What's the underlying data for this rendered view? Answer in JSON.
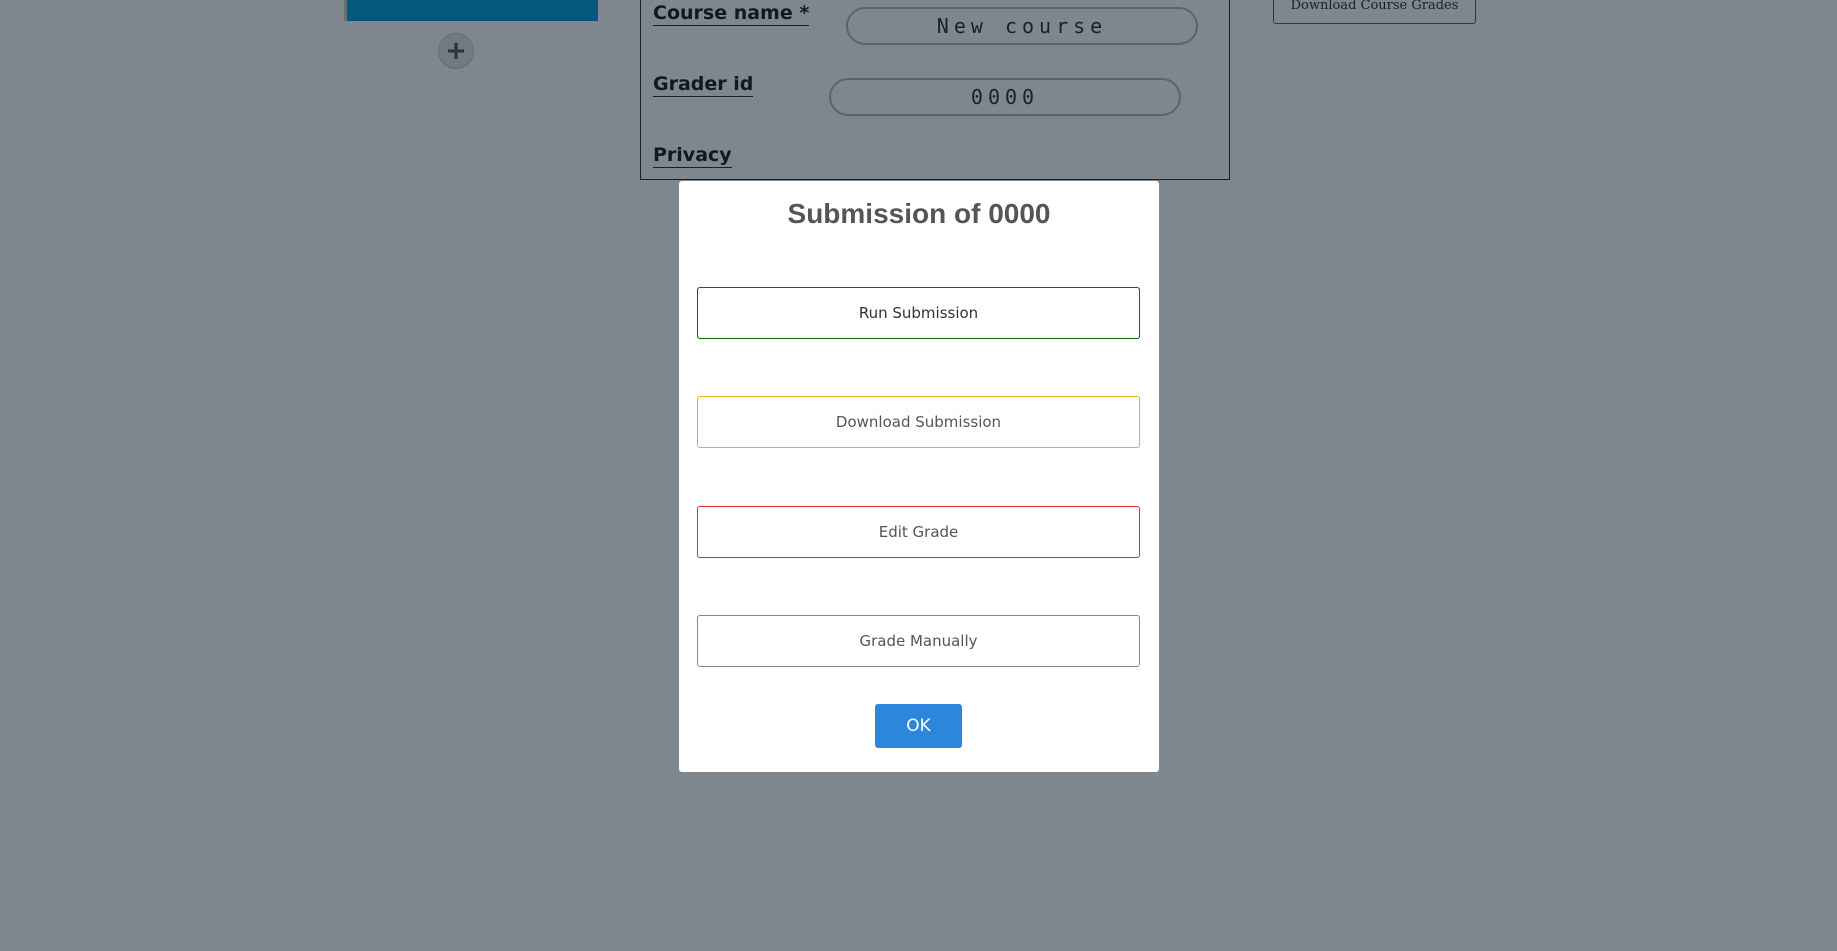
{
  "background": {
    "add_button_symbol": "+",
    "form": {
      "course_name_label": "Course name *",
      "course_name_value": "New course",
      "grader_id_label": "Grader id",
      "grader_id_value": "0000",
      "privacy_label": "Privacy"
    },
    "download_course_grades_label": "Download Course Grades"
  },
  "modal": {
    "title": "Submission of 0000",
    "run_submission_label": "Run Submission",
    "download_submission_label": "Download Submission",
    "edit_grade_label": "Edit Grade",
    "grade_manually_label": "Grade Manually",
    "ok_label": "OK"
  },
  "colors": {
    "overlay": "#7f8b92",
    "left_bar": "#0aa0d8",
    "run_border": "#0a6a0a",
    "download_border": "#e6b020",
    "edit_border": "#d82a2a",
    "ok_background": "#2b86dc"
  }
}
